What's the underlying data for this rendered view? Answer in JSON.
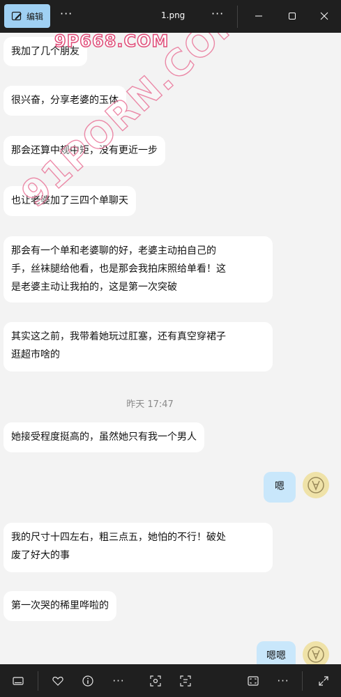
{
  "titlebar": {
    "edit_label": "编辑",
    "more_label": "···",
    "file_name": "1.png",
    "more2_label": "···"
  },
  "watermarks": {
    "top": "9P668.COM",
    "diagonal": "91PORN.COM"
  },
  "messages": [
    {
      "side": "left",
      "text": "我加了几个朋友"
    },
    {
      "side": "left",
      "text": "很兴奋，分享老婆的玉体"
    },
    {
      "side": "left",
      "text": "那会还算中规中矩，没有更近一步"
    },
    {
      "side": "left",
      "text": "也让老婆加了三四个单聊天"
    },
    {
      "side": "left",
      "lines": [
        "那会有一个单和老婆聊的好，老婆主动拍自己的",
        "手，丝袜腿给他看，也是那会我拍床照给单看！这",
        "是老婆主动让我拍的，这是第一次突破"
      ]
    },
    {
      "side": "left",
      "lines": [
        "其实这之前，我带着她玩过肛塞，还有真空穿裙子",
        "逛超市啥的"
      ]
    },
    {
      "side": "left",
      "text": "她接受程度挺高的，虽然她只有我一个男人"
    },
    {
      "side": "right",
      "text": "嗯"
    },
    {
      "side": "left",
      "lines": [
        "我的尺寸十四左右，粗三点五，她怕的不行！破处",
        "废了好大的事"
      ]
    },
    {
      "side": "left",
      "text": "第一次哭的稀里哗啦的"
    },
    {
      "side": "right",
      "text": "嗯嗯"
    }
  ],
  "timestamp": "昨天 17:47",
  "bottombar": {
    "more_label": "···",
    "more2_label": "···"
  },
  "colors": {
    "accent": "#9fd0f3",
    "my_bubble": "#c9e7fb",
    "background": "#f3f3f3",
    "chrome": "#1f1f1f"
  }
}
